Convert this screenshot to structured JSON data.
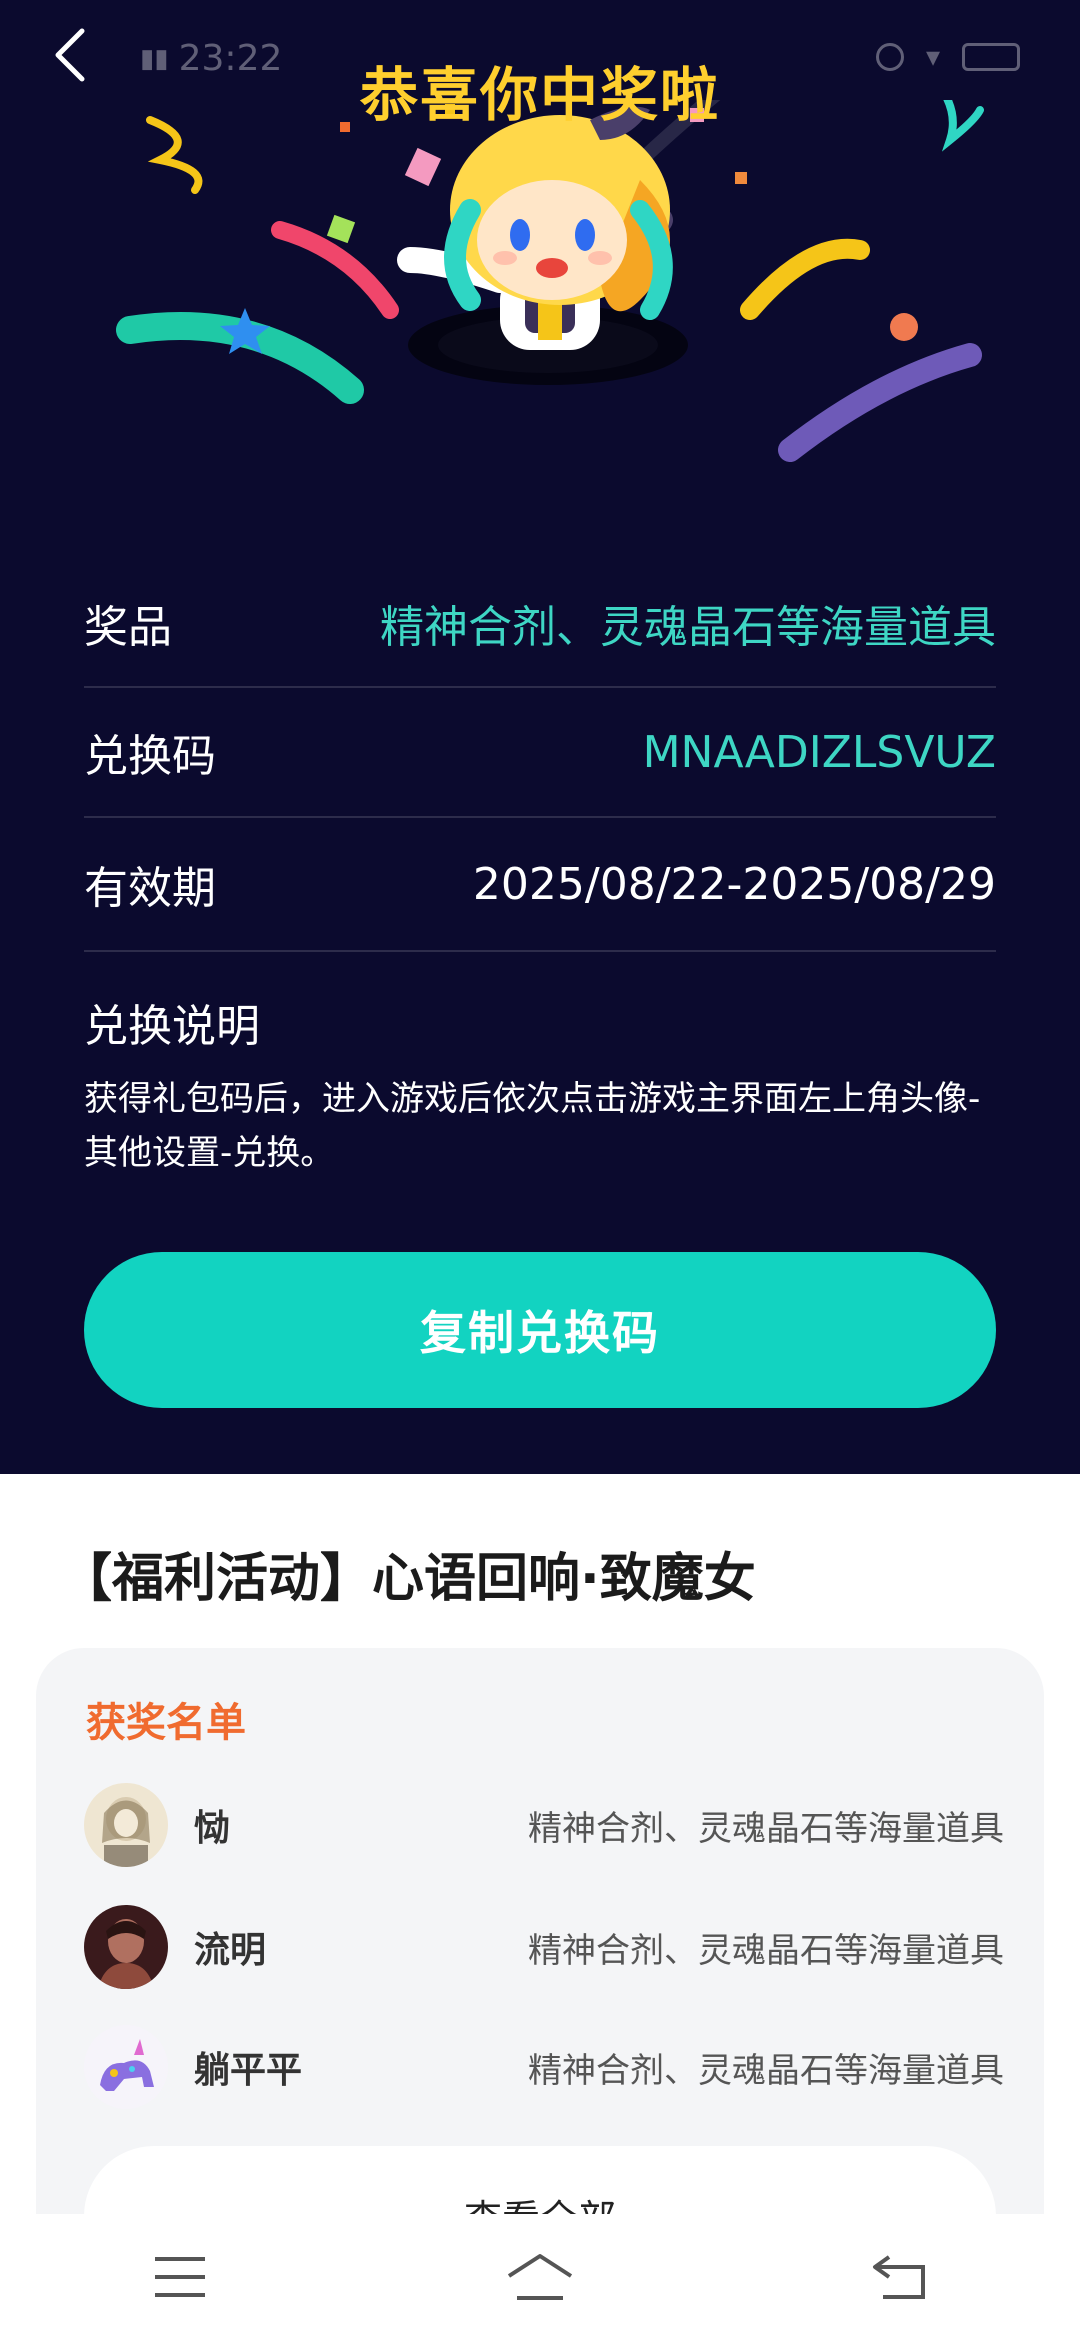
{
  "status_bar": {
    "time": "23:22"
  },
  "header": {
    "title": "恭喜你中奖啦"
  },
  "prize_info": {
    "prize_label": "奖品",
    "prize_value": "精神合剂、灵魂晶石等海量道具",
    "code_label": "兑换码",
    "code_value": "MNAADIZLSVUZ",
    "valid_label": "有效期",
    "valid_value": "2025/08/22-2025/08/29",
    "instructions_title": "兑换说明",
    "instructions_text": "获得礼包码后，进入游戏后依次点击游戏主界面左上角头像-其他设置-兑换。"
  },
  "copy_button": {
    "label": "复制兑换码"
  },
  "activity": {
    "title": "【福利活动】心语回响·致魔女"
  },
  "winners": {
    "heading": "获奖名单",
    "rows": [
      {
        "name": "恸",
        "prize": "精神合剂、灵魂晶石等海量道具"
      },
      {
        "name": "流明",
        "prize": "精神合剂、灵魂晶石等海量道具"
      },
      {
        "name": "躺平平",
        "prize": "精神合剂、灵魂晶石等海量道具"
      }
    ],
    "view_all": "查看全部"
  },
  "colors": {
    "hero_bg": "#0b0a2e",
    "title_yellow": "#ffcf2e",
    "accent_teal": "#12d3c1",
    "winners_heading": "#f06b2f"
  }
}
